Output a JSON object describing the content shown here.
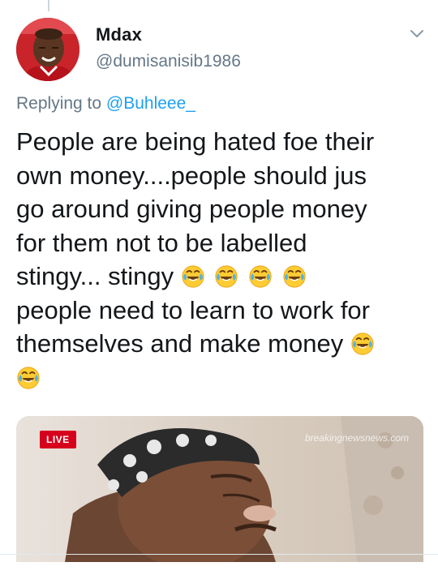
{
  "tweet": {
    "author_name": "Mdax",
    "author_handle": "@dumisanisib1986",
    "replying_prefix": "Replying to ",
    "replying_to": "@Buhleee_",
    "text_lines": [
      "People are being hated foe their",
      "own money....people should jus",
      "go around giving people money",
      "for them not to be labelled",
      "stingy... stingy",
      "people need to learn to work for",
      "themselves and make money"
    ],
    "emoji_name": "face-with-tears-of-joy-emoji"
  },
  "media": {
    "badge": "LIVE",
    "watermark": "breakingnewsnews.com"
  },
  "colors": {
    "text": "#14171a",
    "secondary": "#657786",
    "link": "#1da1f2",
    "live_red": "#d6001c"
  }
}
